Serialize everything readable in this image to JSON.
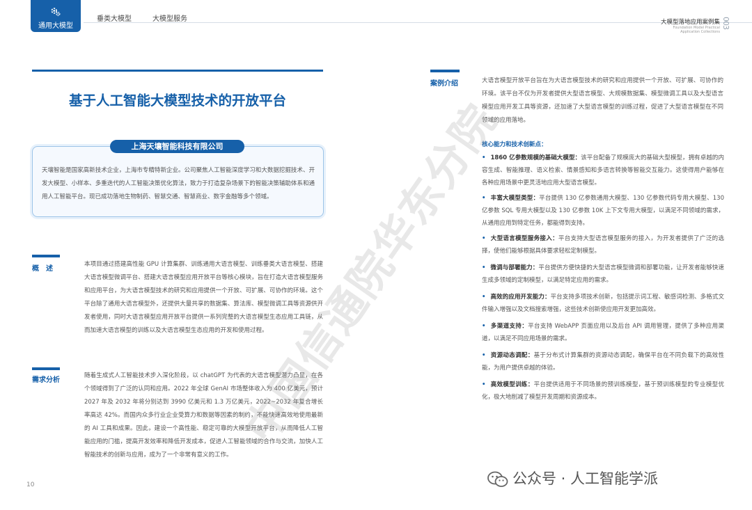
{
  "header": {
    "badge_label": "通用大模型",
    "tabs": [
      "垂类大模型",
      "大模型服务"
    ],
    "series_title": "大模型落地应用案例集",
    "series_subtitle": "Foundation Model Practical Application Collections",
    "page_right": "003"
  },
  "main_title": "基于人工智能大模型技术的开放平台",
  "company": {
    "name": "上海天壤智能科技有限公司",
    "intro": "天壤智能是国家高新技术企业，上海市专精特新企业。公司聚焦人工智能深度学习和大数据挖掘技术、开发大模型、小样本、多重迭代的人工智能决策优化算法，致力于打造复杂场景下的智能决策辅助体系和通用人工智能平台。现已成功落地生物制药、智慧交通、智慧商业、数字金融等多个领域。"
  },
  "overview": {
    "title": "概　述",
    "text": "本项目通过搭建高性能 GPU 计算集群、训练通用大语言模型、训练垂类大语言模型、搭建大语言模型微调平台、搭建大语言模型应用开放平台等核心模块，旨在打造大语言模型服务和应用平台，为大语言模型技术的研究和应用提供一个开放、可扩展、可协作的环境。这个平台除了通用大语言模型外，还提供大量共享的数据集、算法库、模型微调工具等资源供开发者使用，同时大语言模型应用开放平台提供一系列完整的大语言模型生态应用工具链，从而加速大语言模型的训练以及大语言模型生态应用的开发和使用过程。"
  },
  "demand": {
    "title": "需求分析",
    "text": "随着生成式人工智能技术步入深化阶段，以 chatGPT 为代表的大语言模型潜力凸显，在各个领域得到了广泛的认同和应用。2022 年全球 GenAI 市场整体收入为 400 亿美元，预计 2027 年及 2032 年将分别达到 3990 亿美元和 1.3 万亿美元，2022~2032 年复合增长率高达 42%。而国内众多行业企业受算力和数据等因素的制约，不能快速高效地使用最新的 AI 工具和成果。因此，建设一个高性能、稳定可靠的大模型开放平台，从而降低人工智能应用的门槛，提高开发效率和降低开发成本，促进人工智能领域的合作与交流，加快人工智能技术的创新与应用，成为了一个非常有意义的工作。"
  },
  "case": {
    "title": "案例介绍",
    "intro": "大语言模型开放平台旨在为大语言模型技术的研究和应用提供一个开放、可扩展、可协作的环境。该平台不仅为开发者提供大型语言模型、大规模数据集、模型微调工具以及大型语言模型应用开发工具等资源，还加速了大型语言模型的训练过程，促进了大型语言模型在不同领域的应用落地。",
    "innovation_heading": "核心能力和技术创新点：",
    "bullets": [
      {
        "head": "1860 亿参数规模的基础大模型：",
        "text": "该平台配备了规模庞大的基础大型模型，拥有卓越的内容生成、智能推理、语义检索、情景感知和多语言转换等智能交互能力。这使得用户能够在各种应用场景中更灵活地应用大型语言模型。"
      },
      {
        "head": "丰富大模型类型：",
        "text": "平台提供 130 亿参数通用大模型、130 亿参数代码专用大模型、130 亿参数 SQL 专用大模型以及 130 亿参数 10K 上下文专用大模型，以满足不同领域的需求，从通用应用到特定任务，都能得到支持。"
      },
      {
        "head": "大型语言模型服务接入：",
        "text": "平台支持大型语言模型服务的接入，为开发者提供了广泛的选择，使他们能够根据具体要求轻松定制模型。"
      },
      {
        "head": "微调与部署能力：",
        "text": "平台提供方便快捷的大型语言模型微调和部署功能，让开发者能够快速生成多领域的定制模型，以满足特定应用的需求。"
      },
      {
        "head": "高效的应用开发能力：",
        "text": "平台支持多项技术创新，包括提示词工程、敏感词检测、多格式文件输入增强以及文档搜索增强，这些技术创新使应用开发更加高效。"
      },
      {
        "head": "多渠道支持：",
        "text": "平台支持 WebAPP 页面应用以及后台 API 调用管理，提供了多种应用渠道，以满足不同应用场景的需求。"
      },
      {
        "head": "资源动态调配：",
        "text": "基于分布式计算集群的资源动态调配，确保平台在不同负载下的高效性能，为用户提供卓越的体验。"
      },
      {
        "head": "高效模型训练：",
        "text": "平台提供适用于不同场景的预训练模型，基于预训练模型的专业模型优化，极大地削减了模型开发周期和资源成本。"
      }
    ]
  },
  "footer": {
    "page_left": "10",
    "wechat": "公众号 · 人工智能学派"
  },
  "watermark": "中国信通院华东分院"
}
